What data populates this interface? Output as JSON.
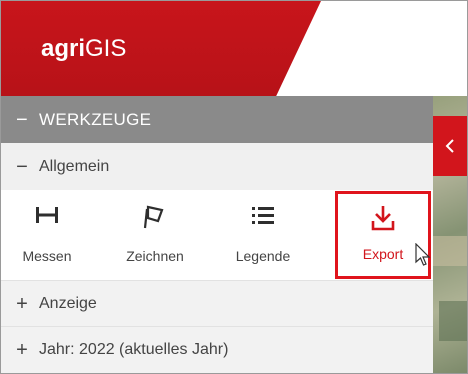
{
  "app": {
    "logo_bold": "agri",
    "logo_rest": "GIS"
  },
  "panel": {
    "section_title": "WERKZEUGE",
    "groups": [
      {
        "label": "Allgemein",
        "expanded": true
      },
      {
        "label": "Anzeige",
        "expanded": false
      },
      {
        "label": "Jahr: 2022 (aktuelles Jahr)",
        "expanded": false
      }
    ]
  },
  "tools": [
    {
      "label": "Messen",
      "icon": "measure-icon"
    },
    {
      "label": "Zeichnen",
      "icon": "draw-polygon-icon"
    },
    {
      "label": "Legende",
      "icon": "legend-list-icon"
    },
    {
      "label": "Export",
      "icon": "download-icon",
      "highlighted": true
    }
  ],
  "signs": {
    "collapse": "−",
    "expand": "+"
  },
  "colors": {
    "brand_red": "#d2151c",
    "section_gray": "#8a8a8a",
    "group_bg": "#f0f0f0"
  }
}
